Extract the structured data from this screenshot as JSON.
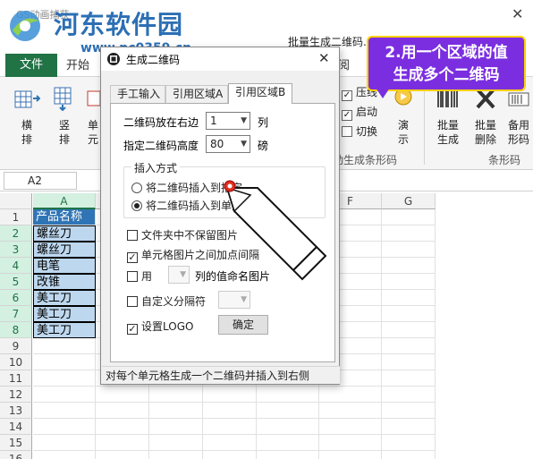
{
  "watermark": {
    "site_name": "河东软件园",
    "url": "www.pc0359.cn",
    "qat_title": "GS动画捕获"
  },
  "window": {
    "title": "批量生成二维码.xl... - Microsoft Excel",
    "close_glyph": "✕"
  },
  "ribbon": {
    "tabs": {
      "file": "文件",
      "home": "开始",
      "view": "阅"
    },
    "buttons": [
      {
        "label1": "横",
        "label2": "排"
      },
      {
        "label1": "竖",
        "label2": "排"
      },
      {
        "label1": "单",
        "label2": "元"
      }
    ],
    "checks": [
      {
        "label": "压线",
        "checked": true
      },
      {
        "label": "启动",
        "checked": true
      },
      {
        "label": "切换",
        "checked": false
      }
    ],
    "demo": {
      "label1": "演",
      "label2": "示"
    },
    "batch_generate": {
      "label1": "批量",
      "label2": "生成"
    },
    "batch_delete": {
      "label1": "批量",
      "label2": "删除"
    },
    "spare": {
      "label1": "备用",
      "label2": "形码"
    },
    "group_qr": "动生成条形码",
    "group_barcode": "条形码"
  },
  "formula_bar": {
    "name_box": "A2"
  },
  "sheet": {
    "columns": [
      "A",
      "B",
      "C",
      "D",
      "E",
      "F",
      "G"
    ],
    "rows": [
      "1",
      "2",
      "3",
      "4",
      "5",
      "6",
      "7",
      "8",
      "9",
      "10",
      "11",
      "12",
      "13",
      "14",
      "15",
      "16"
    ],
    "cells_a": [
      "产品名称",
      "螺丝刀",
      "螺丝刀",
      "电笔",
      "改锥",
      "美工刀",
      "美工刀",
      "美工刀"
    ]
  },
  "dialog": {
    "title": "生成二维码",
    "close": "✕",
    "tabs": [
      "手工输入",
      "引用区域A",
      "引用区域B"
    ],
    "right_label": "二维码放在右边",
    "right_value": "1",
    "right_unit": "列",
    "height_label": "指定二维码高度",
    "height_value": "80",
    "height_unit": "磅",
    "insert_group": "插入方式",
    "radio_folder": "将二维码插入到指定",
    "radio_cell": "将二维码插入到单元",
    "chk_no_keep": "文件夹中不保留图片",
    "chk_spacing": "单元格图片之间加点间隔",
    "chk_use": "用",
    "chk_use_suffix": "列的值命名图片",
    "chk_sep": "自定义分隔符",
    "chk_logo": "设置LOGO",
    "ok": "确定",
    "status": "对每个单元格生成一个二维码并插入到右侧"
  },
  "callout": {
    "line1": "2.用一个区域的值",
    "line2": "生成多个二维码"
  },
  "colors": {
    "excel_green": "#217346",
    "header_blue": "#2f75b5",
    "data_blue": "#bdd7ee",
    "callout_purple": "#7b2ee0",
    "callout_border": "#ffd000"
  }
}
